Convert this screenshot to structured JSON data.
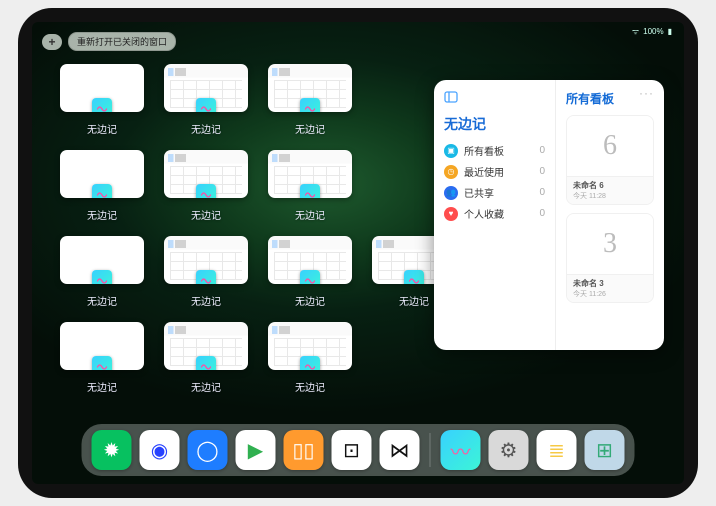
{
  "status": {
    "wifi": "ᯤ",
    "battery": "100%"
  },
  "controls": {
    "plus": "+",
    "reopen": "重新打开已关闭的窗口"
  },
  "app_label": "无边记",
  "windows": [
    {
      "variant": "blank",
      "r": 0,
      "c": 0
    },
    {
      "variant": "full",
      "r": 0,
      "c": 1
    },
    {
      "variant": "full",
      "r": 0,
      "c": 2
    },
    {
      "variant": "blank",
      "r": 1,
      "c": 0
    },
    {
      "variant": "full",
      "r": 1,
      "c": 1
    },
    {
      "variant": "full",
      "r": 1,
      "c": 2
    },
    {
      "variant": "blank",
      "r": 2,
      "c": 0
    },
    {
      "variant": "full",
      "r": 2,
      "c": 1
    },
    {
      "variant": "full",
      "r": 2,
      "c": 2
    },
    {
      "variant": "full",
      "r": 2,
      "c": 3
    },
    {
      "variant": "blank",
      "r": 3,
      "c": 0
    },
    {
      "variant": "full",
      "r": 3,
      "c": 1
    },
    {
      "variant": "full",
      "r": 3,
      "c": 2
    }
  ],
  "detail": {
    "title": "无边记",
    "right_title": "所有看板",
    "more": "···",
    "categories": [
      {
        "icon": "▣",
        "color": "#19b9e6",
        "label": "所有看板",
        "count": "0"
      },
      {
        "icon": "◷",
        "color": "#f5a623",
        "label": "最近使用",
        "count": "0"
      },
      {
        "icon": "👥",
        "color": "#2b6cf0",
        "label": "已共享",
        "count": "0"
      },
      {
        "icon": "♥",
        "color": "#ff4d4d",
        "label": "个人收藏",
        "count": "0"
      }
    ],
    "boards": [
      {
        "glyph": "6",
        "title": "未命名 6",
        "date": "今天 11:28"
      },
      {
        "glyph": "3",
        "title": "未命名 3",
        "date": "今天 11:26"
      }
    ]
  },
  "dock": [
    {
      "name": "wechat",
      "bg": "#07c160",
      "glyph": "✹",
      "fg": "#fff"
    },
    {
      "name": "quark",
      "bg": "#ffffff",
      "glyph": "◉",
      "fg": "#2742ff"
    },
    {
      "name": "qqbrowser",
      "bg": "#1e7dff",
      "glyph": "◯",
      "fg": "#fff"
    },
    {
      "name": "play",
      "bg": "#ffffff",
      "glyph": "▶",
      "fg": "#30b050"
    },
    {
      "name": "books",
      "bg": "#ff9a2e",
      "glyph": "▯▯",
      "fg": "#fff"
    },
    {
      "name": "dice",
      "bg": "#ffffff",
      "glyph": "⊡",
      "fg": "#111"
    },
    {
      "name": "graph",
      "bg": "#ffffff",
      "glyph": "⋈",
      "fg": "#111"
    },
    {
      "sep": true
    },
    {
      "name": "freeform",
      "bg": "linear-gradient(135deg,#38d1ff,#3cf5d7)",
      "glyph": "〰",
      "fg": "#ff5aa0"
    },
    {
      "name": "settings",
      "bg": "#d9d9d9",
      "glyph": "⚙",
      "fg": "#555"
    },
    {
      "name": "notes",
      "bg": "#fff",
      "glyph": "≣",
      "fg": "#f6c945"
    },
    {
      "name": "apps",
      "bg": "#c0d8e8",
      "glyph": "⊞",
      "fg": "#3a7"
    }
  ]
}
